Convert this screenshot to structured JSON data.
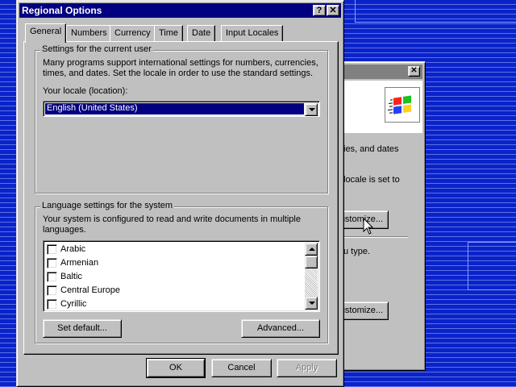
{
  "main_dialog": {
    "title": "Regional Options",
    "title_buttons": {
      "help": "?",
      "close": "✕"
    },
    "tabs": [
      {
        "label": "General",
        "active": true
      },
      {
        "label": "Numbers",
        "active": false
      },
      {
        "label": "Currency",
        "active": false
      },
      {
        "label": "Time",
        "active": false
      },
      {
        "label": "Date",
        "active": false
      },
      {
        "label": "Input Locales",
        "active": false
      }
    ],
    "user_settings": {
      "legend": "Settings for the current user",
      "description_line1": "Many programs support international settings for numbers, currencies,",
      "description_line2": "times, and dates. Set the locale in order to use the standard settings.",
      "locale_label": "Your locale (location):",
      "locale_value": "English (United States)"
    },
    "language_settings": {
      "legend": "Language settings for the system",
      "description_line1": "Your system is configured to read and write documents in multiple",
      "description_line2": "languages.",
      "languages": [
        {
          "label": "Arabic",
          "checked": false
        },
        {
          "label": "Armenian",
          "checked": false
        },
        {
          "label": "Baltic",
          "checked": false
        },
        {
          "label": "Central Europe",
          "checked": false
        },
        {
          "label": "Cyrillic",
          "checked": false
        }
      ],
      "set_default_label": "Set default...",
      "advanced_label": "Advanced..."
    },
    "footer": {
      "ok_label": "OK",
      "cancel_label": "Cancel",
      "apply_label": "Apply"
    }
  },
  "back_dialog": {
    "close": "✕",
    "text_line1": "ies, and dates",
    "text_line2": "locale is set to",
    "customize1_label": "ustomize...",
    "text_line3": "u type.",
    "customize2_label": "ustomize..."
  },
  "colors": {
    "desktop": "#0a23c9",
    "title_active": "#000080",
    "title_inactive": "#808080",
    "face": "#c0c0c0"
  },
  "icons": [
    "windows-logo-icon",
    "mouse-pointer-icon",
    "dropdown-arrow-icon",
    "checkbox-icon"
  ]
}
